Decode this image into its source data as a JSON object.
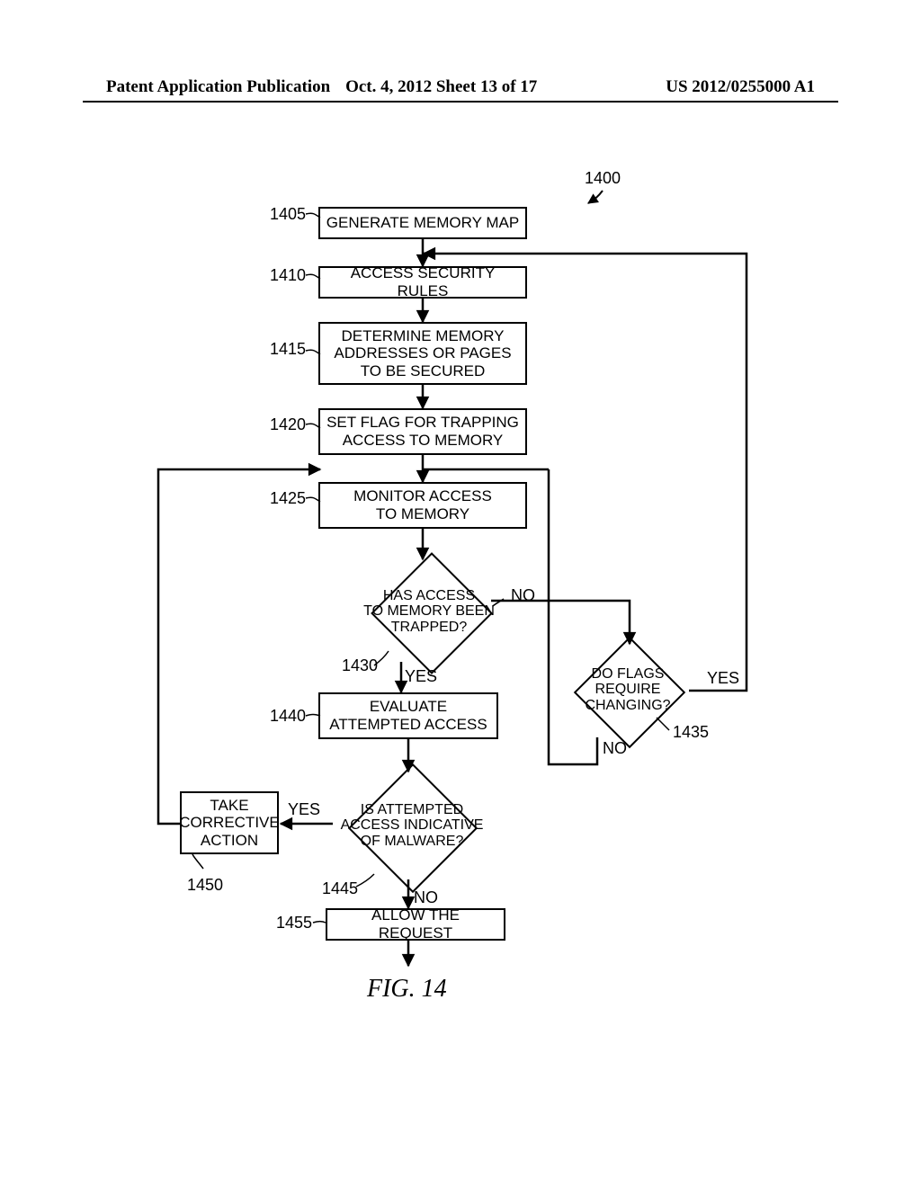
{
  "header": {
    "left": "Patent Application Publication",
    "center": "Oct. 4, 2012   Sheet 13 of 17",
    "right": "US 2012/0255000 A1"
  },
  "flow": {
    "num_1400": "1400",
    "s1405": {
      "ref": "1405",
      "text": "GENERATE MEMORY MAP"
    },
    "s1410": {
      "ref": "1410",
      "text": "ACCESS SECURITY RULES"
    },
    "s1415": {
      "ref": "1415",
      "text": "DETERMINE MEMORY\nADDRESSES OR PAGES\nTO BE SECURED"
    },
    "s1420": {
      "ref": "1420",
      "text": "SET FLAG FOR TRAPPING\nACCESS TO MEMORY"
    },
    "s1425": {
      "ref": "1425",
      "text": "MONITOR ACCESS\nTO MEMORY"
    },
    "d1430": {
      "ref": "1430",
      "text": "HAS ACCESS\nTO MEMORY BEEN\nTRAPPED?"
    },
    "d1435": {
      "ref": "1435",
      "text": "DO FLAGS\nREQUIRE\nCHANGING?"
    },
    "s1440": {
      "ref": "1440",
      "text": "EVALUATE\nATTEMPTED ACCESS"
    },
    "d1445": {
      "ref": "1445",
      "text": "IS ATTEMPTED\nACCESS INDICATIVE\nOF MALWARE?"
    },
    "s1450": {
      "ref": "1450",
      "text": "TAKE\nCORRECTIVE\nACTION"
    },
    "s1455": {
      "ref": "1455",
      "text": "ALLOW THE REQUEST"
    },
    "yes": "YES",
    "no": "NO"
  },
  "figure_label": "FIG. 14"
}
